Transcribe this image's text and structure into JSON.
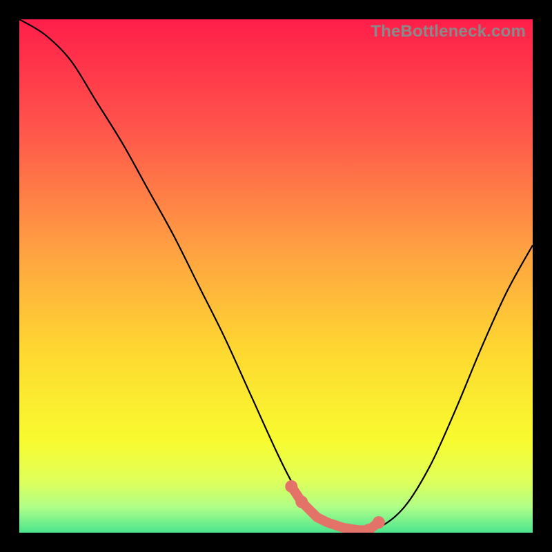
{
  "watermark": "TheBottleneck.com",
  "chart_data": {
    "type": "line",
    "title": "",
    "xlabel": "",
    "ylabel": "",
    "xlim": [
      0,
      100
    ],
    "ylim": [
      0,
      100
    ],
    "background_gradient": {
      "stops": [
        {
          "pos": 0.0,
          "color": "#FF1E4A"
        },
        {
          "pos": 0.22,
          "color": "#FF574B"
        },
        {
          "pos": 0.45,
          "color": "#FFA142"
        },
        {
          "pos": 0.65,
          "color": "#FED930"
        },
        {
          "pos": 0.82,
          "color": "#F8FB2F"
        },
        {
          "pos": 0.9,
          "color": "#DFFF5A"
        },
        {
          "pos": 0.95,
          "color": "#AFFF88"
        },
        {
          "pos": 1.0,
          "color": "#4BE58E"
        }
      ]
    },
    "series": [
      {
        "name": "bottleneck-curve",
        "color": "#000000",
        "x": [
          0,
          5,
          10,
          15,
          20,
          25,
          30,
          35,
          40,
          45,
          50,
          53,
          55,
          58,
          60,
          63,
          66,
          70,
          75,
          80,
          85,
          90,
          95,
          100
        ],
        "y": [
          100,
          97,
          92,
          84,
          76,
          67,
          58,
          48,
          38,
          27,
          16,
          10,
          7,
          4,
          2,
          1,
          0.5,
          1,
          5,
          13,
          24,
          36,
          47,
          56
        ]
      }
    ],
    "optimal_range": {
      "color": "#E37368",
      "points_x": [
        53,
        55,
        58,
        60,
        63,
        66,
        68,
        70
      ],
      "points_y": [
        9,
        6,
        3,
        2,
        1,
        0.5,
        0.5,
        2
      ]
    }
  }
}
